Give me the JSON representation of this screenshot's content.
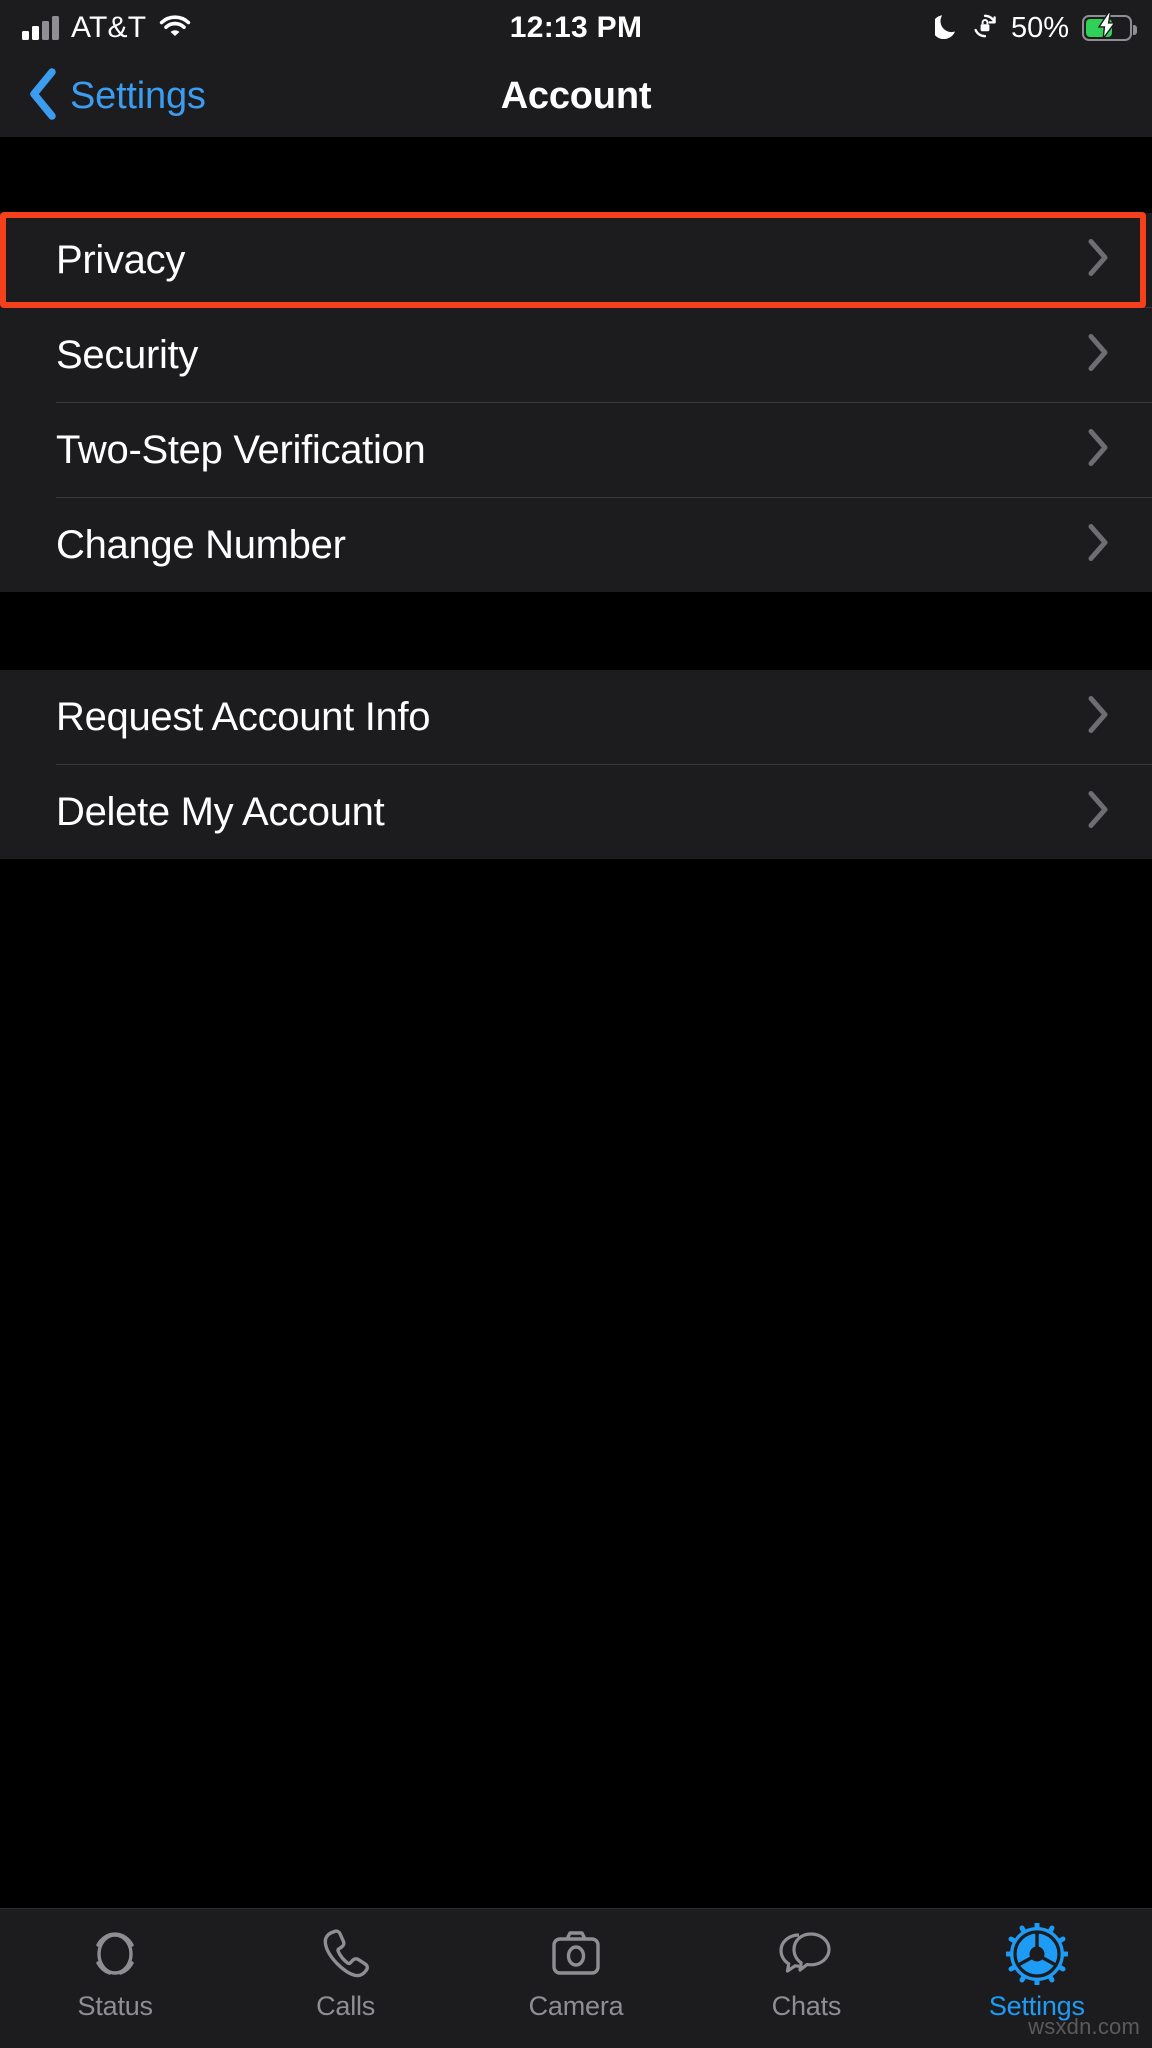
{
  "status_bar": {
    "carrier": "AT&T",
    "time": "12:13 PM",
    "battery_percent": "50%",
    "signal_bars_filled": 2,
    "signal_bars_total": 4,
    "wifi_icon": "wifi-icon",
    "dnd_icon": "moon-icon",
    "rotation_lock_icon": "rotation-lock-icon",
    "battery_icon": "battery-charging-icon",
    "battery_level": 50,
    "charging": true,
    "battery_color": "#30d158"
  },
  "nav_bar": {
    "back_label": "Settings",
    "back_icon": "chevron-left-icon",
    "title": "Account",
    "accent_color": "#3c9cf0"
  },
  "groups": [
    {
      "rows": [
        {
          "label": "Privacy",
          "accessory": "chevron-right-icon",
          "highlighted": true
        },
        {
          "label": "Security",
          "accessory": "chevron-right-icon",
          "highlighted": false
        },
        {
          "label": "Two-Step Verification",
          "accessory": "chevron-right-icon",
          "highlighted": false
        },
        {
          "label": "Change Number",
          "accessory": "chevron-right-icon",
          "highlighted": false
        }
      ]
    },
    {
      "rows": [
        {
          "label": "Request Account Info",
          "accessory": "chevron-right-icon",
          "highlighted": false
        },
        {
          "label": "Delete My Account",
          "accessory": "chevron-right-icon",
          "highlighted": false
        }
      ]
    }
  ],
  "highlight": {
    "color": "#f5411b",
    "target_label": "Privacy"
  },
  "tab_bar": {
    "active_color": "#1e9bf5",
    "inactive_color": "#8e8e93",
    "tabs": [
      {
        "label": "Status",
        "icon": "status-rings-icon",
        "active": false
      },
      {
        "label": "Calls",
        "icon": "phone-icon",
        "active": false
      },
      {
        "label": "Camera",
        "icon": "camera-icon",
        "active": false
      },
      {
        "label": "Chats",
        "icon": "chat-bubbles-icon",
        "active": false
      },
      {
        "label": "Settings",
        "icon": "gear-icon",
        "active": true
      }
    ]
  },
  "watermark": "wsxdn.com"
}
